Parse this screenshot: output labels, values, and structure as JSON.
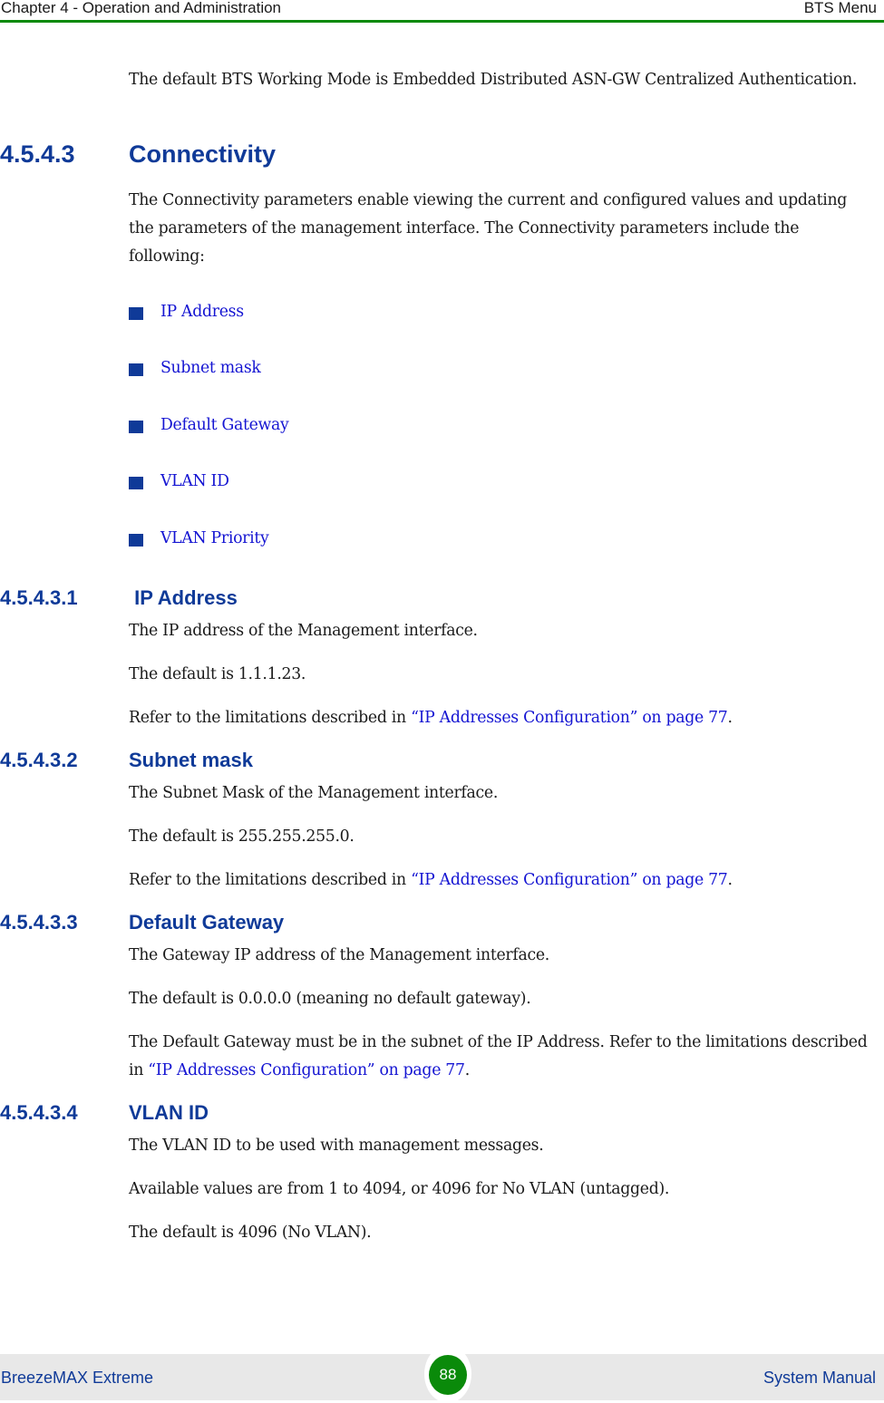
{
  "header": {
    "chapter": "Chapter 4 - Operation and Administration",
    "section": "BTS Menu",
    "rule_color": "#0a8a0a"
  },
  "intro": {
    "text": "The default BTS Working Mode is Embedded Distributed ASN-GW Centralized Authentication."
  },
  "connectivity": {
    "number": "4.5.4.3",
    "title": "Connectivity",
    "description": "The Connectivity parameters enable viewing the current and configured values and updating the parameters of the management interface. The Connectivity parameters include the following:",
    "bullets": [
      {
        "label": "IP Address",
        "icon": "square-bullet-icon"
      },
      {
        "label": "Subnet mask",
        "icon": "square-bullet-icon"
      },
      {
        "label": "Default Gateway",
        "icon": "square-bullet-icon"
      },
      {
        "label": "VLAN ID",
        "icon": "square-bullet-icon"
      },
      {
        "label": "VLAN Priority",
        "icon": "square-bullet-icon"
      }
    ]
  },
  "subsections": {
    "ip_address": {
      "number": "4.5.4.3.1",
      "title": " IP Address",
      "p1": "The IP address of the Management interface.",
      "p2": "The default is 1.1.1.23.",
      "p3_prefix": "Refer to the limitations described in ",
      "p3_link": "“IP Addresses Configuration” on page 77",
      "p3_suffix": "."
    },
    "subnet_mask": {
      "number": "4.5.4.3.2",
      "title": "Subnet mask",
      "p1": "The Subnet Mask of the Management interface.",
      "p2": "The default is 255.255.255.0.",
      "p3_prefix": "Refer to the limitations described in ",
      "p3_link": "“IP Addresses Configuration” on page 77",
      "p3_suffix": "."
    },
    "default_gateway": {
      "number": "4.5.4.3.3",
      "title": "Default Gateway",
      "p1": "The Gateway IP address of the Management interface.",
      "p2": "The default is 0.0.0.0 (meaning no default gateway).",
      "p3_prefix": "The Default Gateway must be in the subnet of the IP Address. Refer to the limitations described in ",
      "p3_link": "“IP Addresses Configuration” on page 77",
      "p3_suffix": "."
    },
    "vlan_id": {
      "number": "4.5.4.3.4",
      "title": "VLAN ID",
      "p1": "The VLAN ID to be used with management messages.",
      "p2": "Available values are from 1 to 4094, or 4096 for No VLAN (untagged).",
      "p3": "The default is 4096 (No VLAN)."
    }
  },
  "footer": {
    "product": "BreezeMAX Extreme",
    "page_number": "88",
    "doc_type": "System Manual",
    "badge_color": "#0a8a0a"
  },
  "colors": {
    "heading": "#0f3a98",
    "link": "#1414d2",
    "footer_bg": "#e8e8e8"
  }
}
